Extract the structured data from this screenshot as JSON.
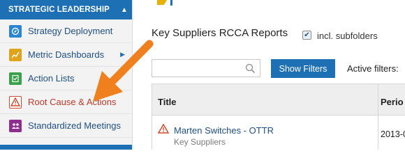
{
  "sidebar": {
    "header": "STRATEGIC LEADERSHIP",
    "header_icon": "caret-up-icon",
    "items": [
      {
        "label": "Strategy Deployment",
        "icon": "compass-icon",
        "color": "#2b86d2"
      },
      {
        "label": "Metric Dashboards",
        "icon": "chart-icon",
        "color": "#e0a41a",
        "has_submenu": true
      },
      {
        "label": "Action Lists",
        "icon": "checklist-icon",
        "color": "#3aa14a"
      },
      {
        "label": "Root Cause & Actions",
        "icon": "warning-icon",
        "color": "#d24b2a",
        "active": true
      },
      {
        "label": "Standardized Meetings",
        "icon": "people-icon",
        "color": "#8e2e8e"
      }
    ]
  },
  "main": {
    "title": "Key Suppliers RCCA Reports",
    "include_subfolders": {
      "label": "incl. subfolders",
      "checked": true
    },
    "search": {
      "placeholder": "",
      "value": ""
    },
    "show_filters_label": "Show Filters",
    "active_filters_label": "Active filters:",
    "table": {
      "columns": [
        "Title",
        "Perio"
      ],
      "rows": [
        {
          "title": "Marten Switches - OTTR",
          "subtitle": "Key Suppliers",
          "period": "2013-0",
          "icon": "warning-icon"
        }
      ]
    }
  },
  "colors": {
    "brand_blue": "#1e70b5",
    "annotation_orange": "#f07f1e",
    "active_red": "#c0392b"
  }
}
